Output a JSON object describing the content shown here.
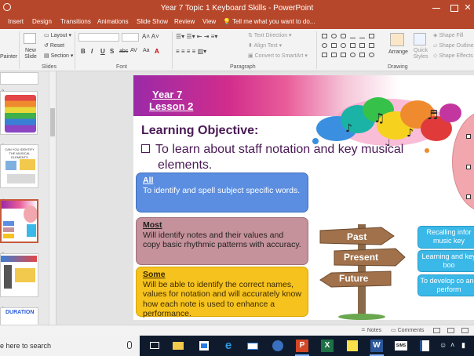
{
  "window": {
    "title": "Year 7 Topic 1 Keyboard Skills - PowerPoint"
  },
  "tabs": [
    "Insert",
    "Design",
    "Transitions",
    "Animations",
    "Slide Show",
    "Review",
    "View"
  ],
  "tell_me": "Tell me what you want to do...",
  "ribbon": {
    "painter": "Painter",
    "new_slide": "New Slide",
    "layout": "Layout",
    "reset": "Reset",
    "section": "Section",
    "groups": {
      "slides": "Slides",
      "font": "Font",
      "paragraph": "Paragraph",
      "drawing": "Drawing"
    },
    "text_direction": "Text Direction",
    "align_text": "Align Text",
    "convert_smartart": "Convert to SmartArt",
    "arrange": "Arrange",
    "quick_styles": "Quick Styles",
    "shape_fill": "Shape Fill",
    "shape_outline": "Shape Outline",
    "shape_effects": "Shape Effects",
    "font_buttons": [
      "B",
      "I",
      "U",
      "S",
      "abc",
      "AV",
      "Aa",
      "A"
    ]
  },
  "thumbnails": {
    "numbers": [
      "2",
      "3",
      "4",
      "5",
      "6"
    ],
    "slide3_caption": "CAN YOU IDENTIFY THE MUSICAL ELEMENTS",
    "slide6_caption": "DURATION"
  },
  "slide": {
    "year": "Year 7",
    "lesson": "Lesson 2",
    "lo_title": "Learning Objective:",
    "lo_line1": "To learn about staff notation and key musical",
    "lo_line2": "elements.",
    "all": {
      "heading": "All",
      "text": "To identify and spell subject specific words."
    },
    "most": {
      "heading": "Most",
      "text": "Will identify notes and their values and copy basic rhythmic patterns with accuracy."
    },
    "some": {
      "heading": "Some",
      "text": "Will be able to identify the correct names, values for notation and will accurately know how each note is used to enhance a performance."
    },
    "sign": {
      "past": "Past",
      "present": "Present",
      "future": "Future"
    },
    "right_boxes": [
      "Recalling infor music key",
      "Learning and key boo",
      "To develop co and perform"
    ]
  },
  "statusbar": {
    "notes": "Notes",
    "comments": "Comments"
  },
  "taskbar": {
    "search": "e here to search"
  }
}
